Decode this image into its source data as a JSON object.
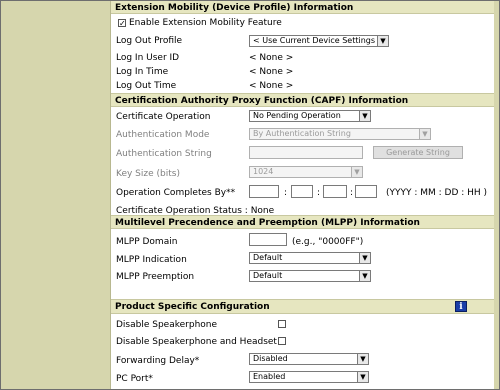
{
  "sections": {
    "extension_mobility": "Extension Mobility (Device Profile) Information",
    "capf": "Certification Authority Proxy Function (CAPF) Information",
    "mlpp": "Multilevel Precendence and Preemption (MLPP) Information",
    "product_specific": "Product Specific Configuration"
  },
  "extension_mobility": {
    "enable_label": "Enable Extension Mobility Feature",
    "enable_checked": true,
    "logout_profile_label": "Log Out Profile",
    "logout_profile_value": "< Use Current Device Settings >",
    "login_user_label": "Log In User ID",
    "login_user_value": "< None >",
    "login_time_label": "Log In Time",
    "login_time_value": "< None >",
    "logout_time_label": "Log Out Time",
    "logout_time_value": "< None >"
  },
  "capf": {
    "cert_op_label": "Certificate Operation",
    "cert_op_value": "No Pending Operation",
    "auth_mode_label": "Authentication Mode",
    "auth_mode_value": "By Authentication String",
    "auth_string_label": "Authentication String",
    "generate_button": "Generate String",
    "key_size_label": "Key Size (bits)",
    "key_size_value": "1024",
    "op_completes_label": "Operation Completes By**",
    "date_format": "(YYYY : MM : DD : HH )",
    "colon": ":",
    "status_label": "Certificate Operation Status : None"
  },
  "mlpp": {
    "domain_label": "MLPP Domain",
    "domain_hint": "(e.g., \"0000FF\")",
    "indication_label": "MLPP Indication",
    "indication_value": "Default",
    "preemption_label": "MLPP Preemption",
    "preemption_value": "Default"
  },
  "product_specific": {
    "info_icon_glyph": "i",
    "disable_speakerphone_label": "Disable Speakerphone",
    "disable_speaker_headset_label": "Disable Speakerphone and Headset",
    "forwarding_delay_label": "Forwarding Delay*",
    "forwarding_delay_value": "Disabled",
    "pc_port_label": "PC Port*",
    "pc_port_value": "Enabled"
  },
  "icons": {
    "dropdown": "chevron-down-icon",
    "info": "info-icon"
  },
  "colors": {
    "section_header_bg": "#e6e6c0",
    "side_bg": "#d6d6ad",
    "info_icon": "#1a3ea8"
  }
}
